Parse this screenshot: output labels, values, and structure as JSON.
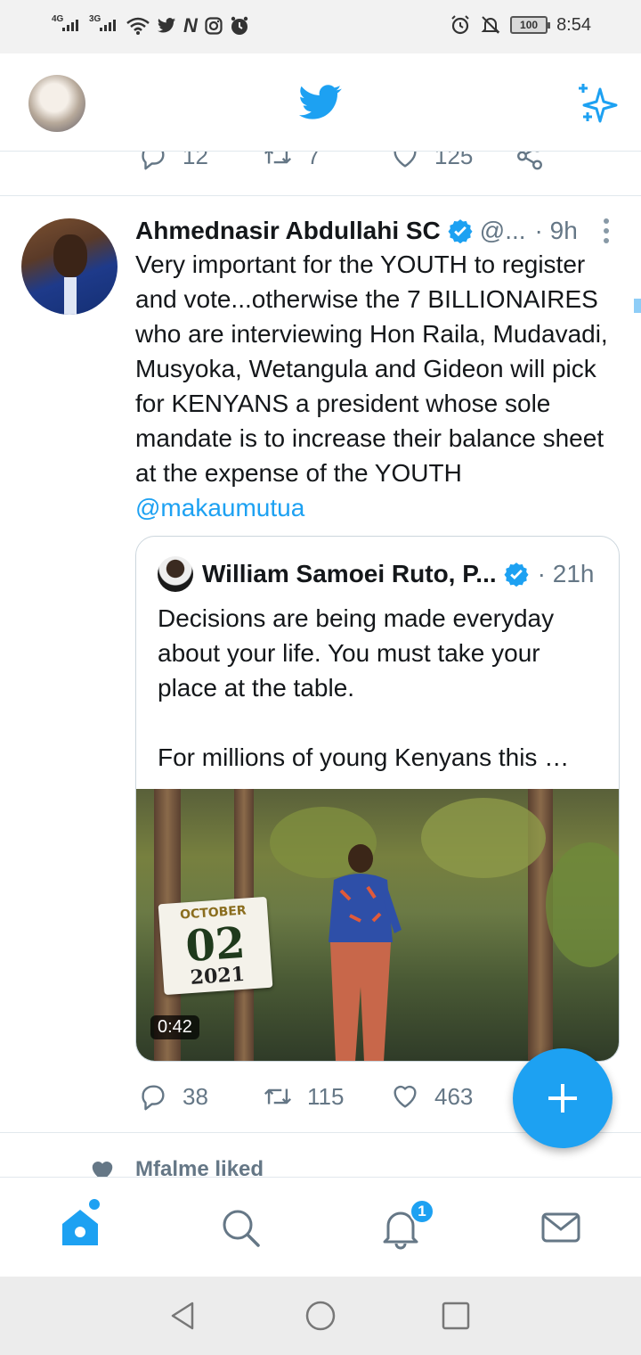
{
  "status_bar": {
    "left": {
      "net1": "4G",
      "net2": "3G"
    },
    "right": {
      "battery": "100",
      "time": "8:54"
    }
  },
  "topbar": {
    "logo": "twitter-bird-icon",
    "sparkle": "sparkle-icon"
  },
  "prev_tweet_actions": {
    "replies": "12",
    "retweets": "7",
    "likes": "125"
  },
  "tweet": {
    "name": "Ahmednasir Abdullahi SC",
    "handle": "@...",
    "time": "· 9h",
    "text": "Very important for the YOUTH to register and vote...otherwise the 7 BILLIONAIRES who are interviewing Hon Raila, Mudavadi, Musyoka, Wetangula and Gideon will pick for KENYANS a president whose sole mandate is to increase their balance sheet at the expense of the YOUTH ",
    "mention": "@makaumutua",
    "quote": {
      "name": "William Samoei Ruto, P...",
      "time": "· 21h",
      "text": "Decisions are being made everyday about your life. You must take your place at the table.\n\nFor millions of young Kenyans this …",
      "media": {
        "calendar_month": "OCTOBER",
        "calendar_day": "02",
        "calendar_year": "2021",
        "duration": "0:42"
      }
    },
    "actions": {
      "replies": "38",
      "retweets": "115",
      "likes": "463"
    }
  },
  "next_item": {
    "text": "Mfalme liked"
  },
  "bottom_nav": {
    "notifications_badge": "1"
  },
  "colors": {
    "accent": "#1da1f2",
    "secondary_text": "#657786",
    "border": "#e1e8ed"
  }
}
